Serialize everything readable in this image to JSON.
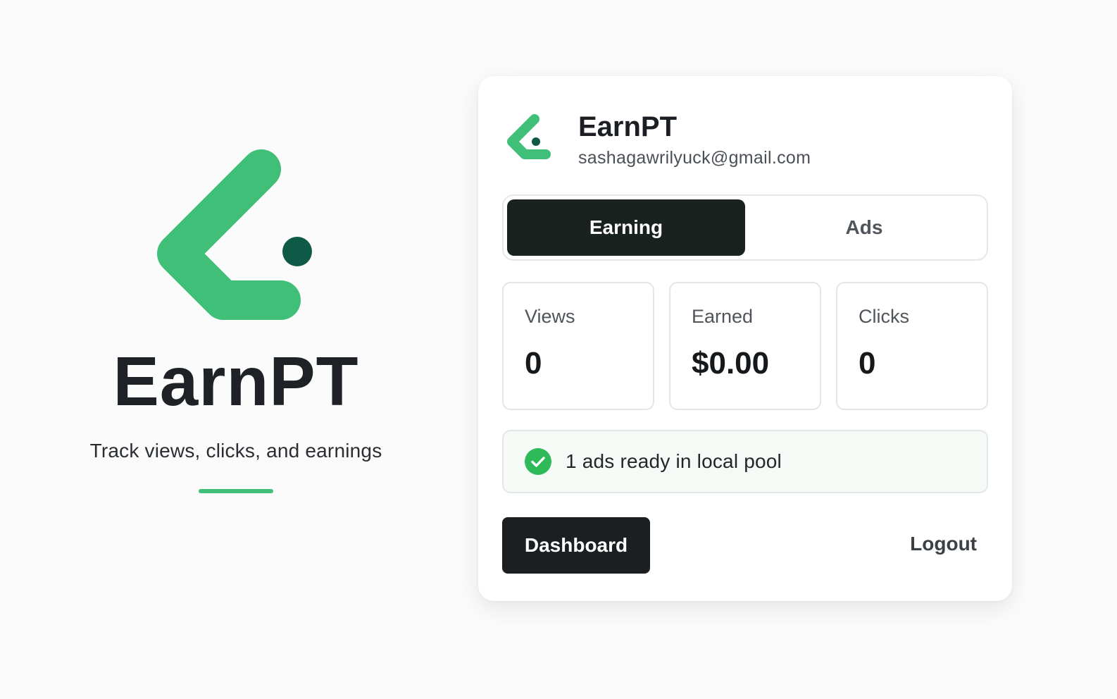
{
  "brand": {
    "name": "EarnPT",
    "tagline": "Track views, clicks, and earnings",
    "colors": {
      "primary_green": "#3fbf78",
      "dot_dark_green": "#0f5a47",
      "dark": "#1a221f",
      "success": "#2fba5a"
    }
  },
  "card": {
    "title": "EarnPT",
    "email": "sashagawrilyuck@gmail.com",
    "tabs": [
      {
        "label": "Earning",
        "active": true
      },
      {
        "label": "Ads",
        "active": false
      }
    ],
    "stats": [
      {
        "label": "Views",
        "value": "0"
      },
      {
        "label": "Earned",
        "value": "$0.00"
      },
      {
        "label": "Clicks",
        "value": "0"
      }
    ],
    "status": {
      "icon": "check-circle-icon",
      "text": "1 ads ready in local pool"
    },
    "footer": {
      "dashboard_label": "Dashboard",
      "logout_label": "Logout"
    }
  }
}
